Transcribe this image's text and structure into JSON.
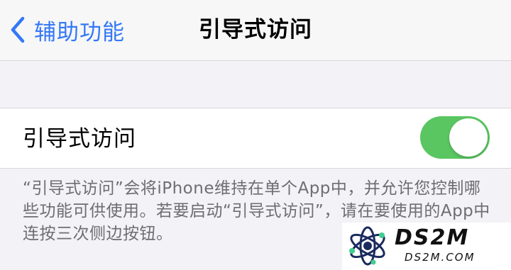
{
  "nav": {
    "back_label": "辅助功能",
    "title": "引导式访问",
    "accent_color": "#3478f6"
  },
  "guided_access": {
    "label": "引导式访问",
    "toggle_on": true,
    "toggle_color": "#5ac661"
  },
  "footer": {
    "description": "“引导式访问”会将iPhone维持在单个App中，并允许您控制哪些功能可供使用。若要启动“引导式访问”，请在要使用的App中连按三次侧边按钮。"
  },
  "watermark": {
    "main": "DS2M",
    "sub": "DS2M.COM"
  },
  "icons": [
    "chevron-left-icon",
    "atom-logo-icon"
  ]
}
